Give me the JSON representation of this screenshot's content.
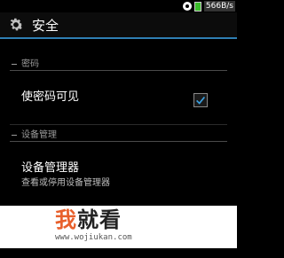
{
  "status_bar": {
    "network_speed": "566B/s",
    "icons": [
      "app-icon",
      "battery-icon"
    ],
    "battery_color": "#3bbd2b"
  },
  "header": {
    "icon": "gear-icon",
    "title": "安全",
    "accent_color": "#2f7fb3"
  },
  "sections": [
    {
      "header": "密码",
      "items": [
        {
          "title": "使密码可见",
          "checked": true
        }
      ]
    },
    {
      "header": "设备管理",
      "items": [
        {
          "title": "设备管理器",
          "summary": "查看或停用设备管理器"
        }
      ]
    }
  ],
  "watermark": {
    "char1": "我",
    "rest": "就看",
    "url": "www.wojiukan.com",
    "accent_color": "#e8602c"
  }
}
